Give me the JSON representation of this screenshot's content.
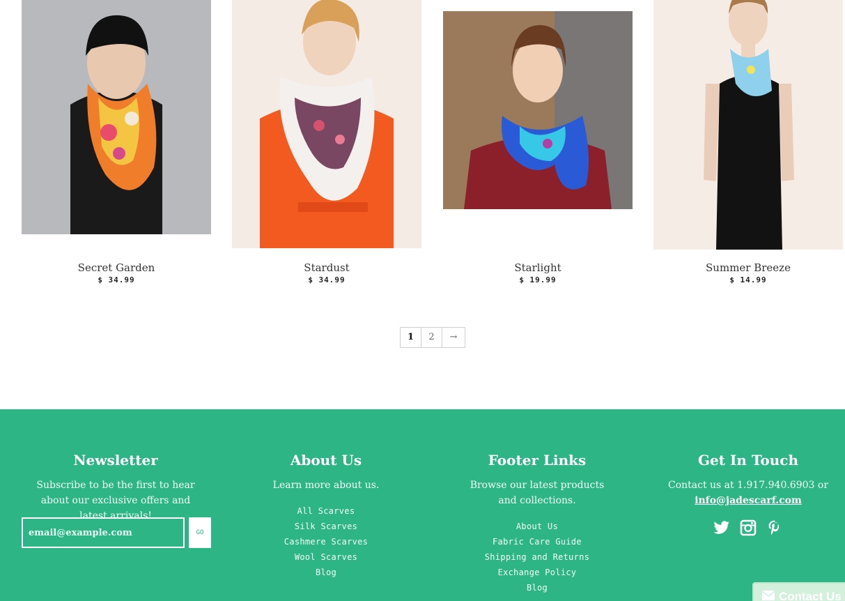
{
  "products": [
    {
      "name": "Secret Garden",
      "price": "$ 34.99"
    },
    {
      "name": "Stardust",
      "price": "$ 34.99"
    },
    {
      "name": "Starlight",
      "price": "$ 19.99"
    },
    {
      "name": "Summer Breeze",
      "price": "$ 14.99"
    }
  ],
  "pagination": {
    "pages": [
      "1",
      "2"
    ],
    "next": "→",
    "current": "1"
  },
  "footer": {
    "newsletter": {
      "title": "Newsletter",
      "desc": "Subscribe to be the first to hear about our exclusive offers and latest arrivals!",
      "placeholder": "email@example.com",
      "button": "GO"
    },
    "about": {
      "title": "About Us",
      "desc": "Learn more about us.",
      "links": [
        "All Scarves",
        "Silk Scarves",
        "Cashmere Scarves",
        "Wool Scarves",
        "Blog"
      ]
    },
    "links": {
      "title": "Footer Links",
      "desc": "Browse our latest products and collections.",
      "links": [
        "About Us",
        "Fabric Care Guide",
        "Shipping and Returns",
        "Exchange Policy",
        "Blog"
      ]
    },
    "contact": {
      "title": "Get In Touch",
      "desc_prefix": "Contact us at 1.917.940.6903 or",
      "email": "info@jadescarf.com",
      "social_icons": [
        "twitter-icon",
        "instagram-icon",
        "pinterest-icon"
      ]
    }
  },
  "contact_tab": {
    "label": "Contact Us",
    "icon": "envelope-icon"
  },
  "colors": {
    "footer_bg": "#2db585",
    "text": "#333333"
  }
}
